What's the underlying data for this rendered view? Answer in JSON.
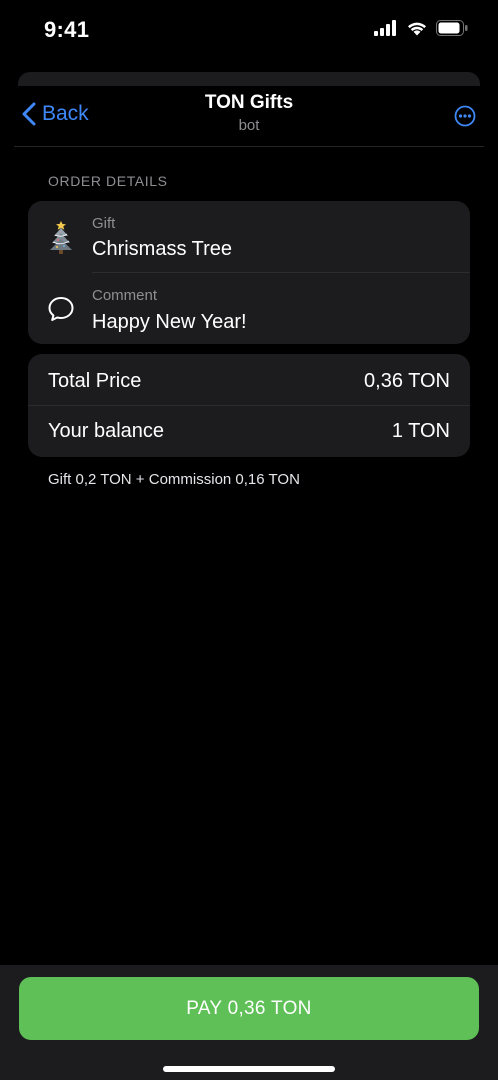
{
  "status_bar": {
    "time": "9:41"
  },
  "nav": {
    "back_label": "Back",
    "title": "TON Gifts",
    "subtitle": "bot"
  },
  "order": {
    "section_title": "ORDER DETAILS",
    "gift_label": "Gift",
    "gift_value": "Chrismass Tree",
    "comment_label": "Comment",
    "comment_value": "Happy New Year!"
  },
  "pricing": {
    "total_label": "Total Price",
    "total_value": "0,36 TON",
    "balance_label": "Your balance",
    "balance_value": "1 TON",
    "breakdown": "Gift 0,2 TON + Commission 0,16 TON"
  },
  "pay_button_label": "PAY 0,36 TON",
  "colors": {
    "accent": "#3e88f7",
    "pay_button": "#5ec057",
    "card": "#1c1c1e"
  }
}
